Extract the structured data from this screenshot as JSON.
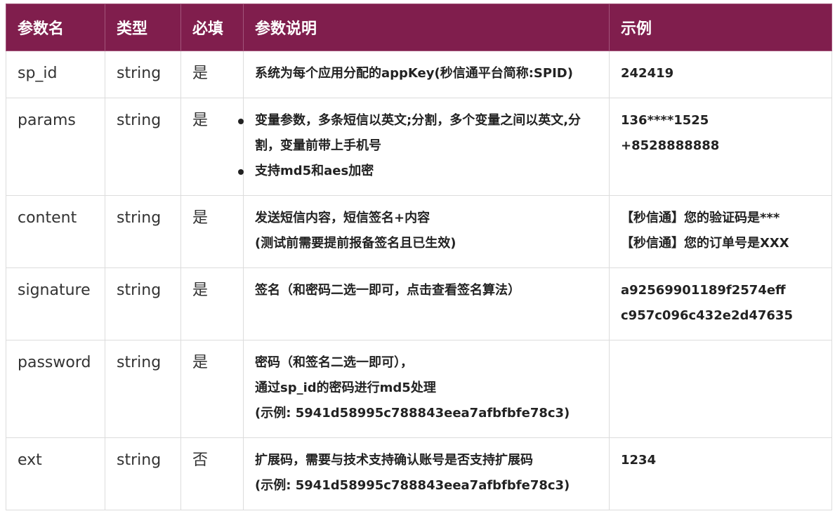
{
  "header": {
    "col_name": "参数名",
    "col_type": "类型",
    "col_required": "必填",
    "col_desc": "参数说明",
    "col_example": "示例"
  },
  "rows": [
    {
      "name": "sp_id",
      "type": "string",
      "required": "是",
      "desc": [
        "系统为每个应用分配的appKey(秒信通平台简称:SPID)"
      ],
      "example": [
        "242419"
      ]
    },
    {
      "name": "params",
      "type": "string",
      "required": "是",
      "desc": [
        "变量参数，多条短信以英文;分割，多个变量之间以英文,分割，变量前带上手机号",
        "支持md5和aes加密"
      ],
      "example": [
        "136****1525",
        "+8528888888"
      ]
    },
    {
      "name": "content",
      "type": "string",
      "required": "是",
      "desc": [
        "发送短信内容，短信签名+内容",
        "(测试前需要提前报备签名且已生效)"
      ],
      "example": [
        "【秒信通】您的验证码是***",
        "【秒信通】您的订单号是XXX"
      ]
    },
    {
      "name": "signature",
      "type": "string",
      "required": "是",
      "desc": [
        "签名（和密码二选一即可，点击查看签名算法）"
      ],
      "example": [
        "a92569901189f2574eff",
        "c957c096c432e2d47635"
      ]
    },
    {
      "name": "password",
      "type": "string",
      "required": "是",
      "desc": [
        "密码（和签名二选一即可），",
        "通过sp_id的密码进行md5处理",
        "(示例: 5941d58995c788843eea7afbfbfe78c3)"
      ],
      "example": []
    },
    {
      "name": "ext",
      "type": "string",
      "required": "否",
      "desc": [
        "扩展码，需要与技术支持确认账号是否支持扩展码",
        "(示例: 5941d58995c788843eea7afbfbfe78c3)"
      ],
      "example": [
        "1234"
      ]
    }
  ],
  "colors": {
    "header_bg": "#801e4d",
    "header_text": "#ffffff",
    "border": "#dcdcdc"
  }
}
